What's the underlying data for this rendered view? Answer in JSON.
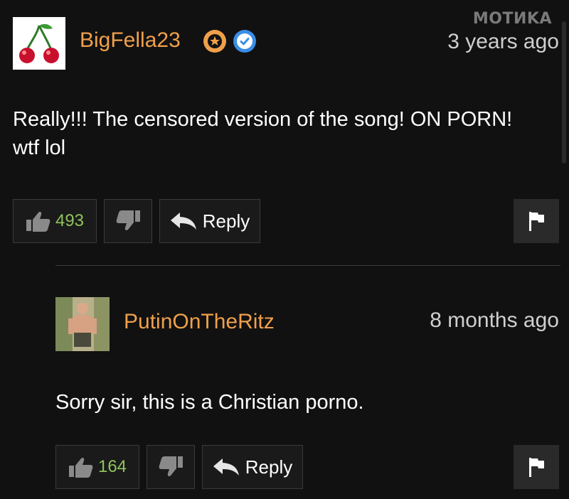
{
  "watermark": "MOTИKA",
  "comments": [
    {
      "username": "BigFella23",
      "timestamp": "3 years ago",
      "text": "Really!!!  The censored version of the song! ON PORN! wtf lol",
      "likes": "493",
      "reply_label": "Reply",
      "avatar_icon": "cherries-icon",
      "badges": [
        "star-badge-icon",
        "verified-badge-icon"
      ]
    },
    {
      "username": "PutinOnTheRitz",
      "timestamp": "8 months ago",
      "text": "Sorry sir, this is a Christian porno.",
      "likes": "164",
      "reply_label": "Reply",
      "avatar_icon": "profile-photo"
    }
  ],
  "colors": {
    "background": "#111111",
    "username": "#f0a04b",
    "likes": "#8fc35a",
    "verified": "#3a8ee6"
  }
}
